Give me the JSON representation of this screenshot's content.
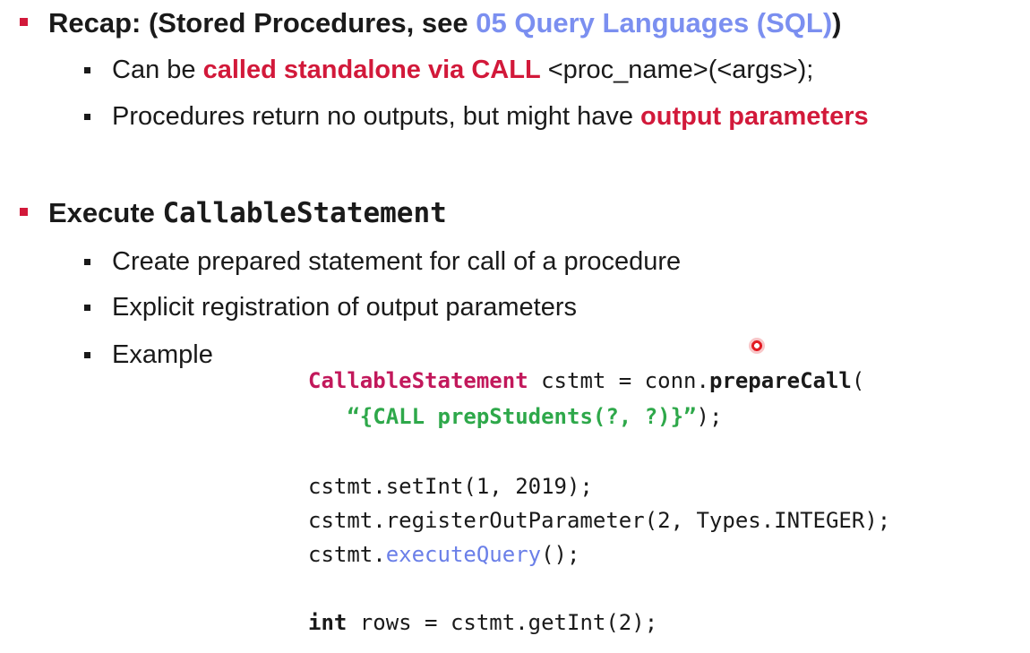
{
  "section1": {
    "prefix": "Recap: (Stored Procedures, see ",
    "link": "05 Query Languages (SQL)",
    "suffix": ")",
    "bullets": {
      "b1": {
        "pre": "Can be ",
        "emph": "called standalone via CALL",
        "post": " <proc_name>(<args>);"
      },
      "b2": {
        "pre": "Procedures return no outputs, but might have ",
        "emph": "output parameters"
      }
    }
  },
  "section2": {
    "prefix": "Execute ",
    "code_word": "CallableStatement",
    "bullets": {
      "b1": "Create prepared statement for call of a procedure",
      "b2": "Explicit registration of output parameters",
      "b3": "Example"
    }
  },
  "code": {
    "line1": {
      "type": "CallableStatement",
      "rest1": " cstmt = conn.",
      "method": "prepareCall",
      "rest2": "("
    },
    "line2": {
      "indent": "   ",
      "string": "“{CALL prepStudents(?, ?)}”",
      "rest": ");"
    },
    "line3": "cstmt.setInt(1, 2019);",
    "line4": "cstmt.registerOutParameter(2, Types.INTEGER);",
    "line5": {
      "pre": "cstmt.",
      "method": "executeQuery",
      "post": "();"
    },
    "line6": {
      "kw": "int",
      "rest": " rows = cstmt.getInt(2);"
    }
  }
}
